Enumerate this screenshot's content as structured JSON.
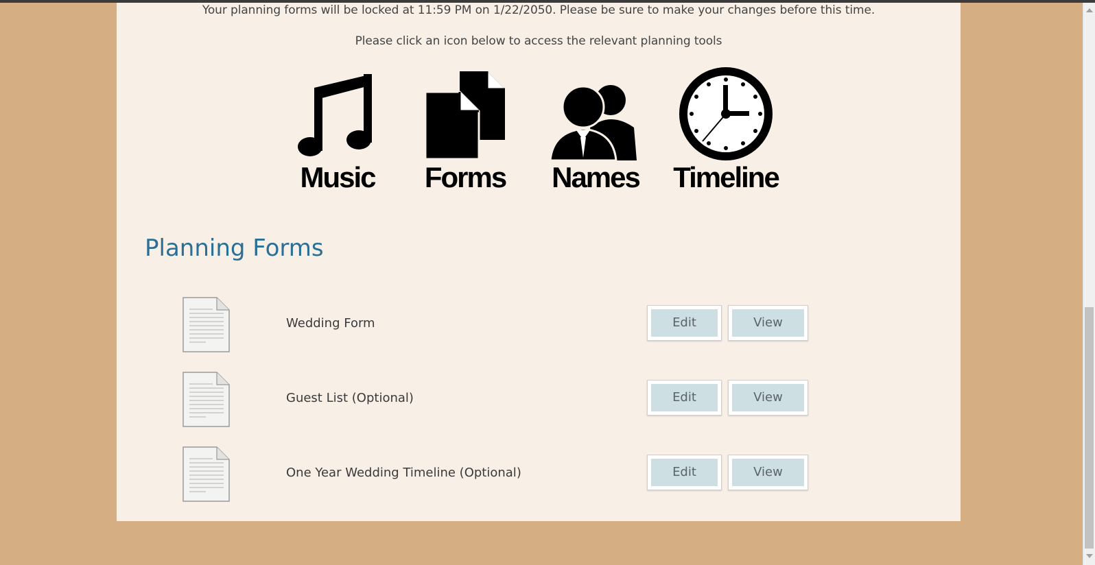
{
  "notices": {
    "lock": "Your planning forms will be locked at 11:59 PM on 1/22/2050. Please be sure to make your changes before this time.",
    "click": "Please click an icon below to access the relevant planning tools"
  },
  "tools": [
    {
      "label": "Music",
      "icon": "music-note-icon"
    },
    {
      "label": "Forms",
      "icon": "documents-icon"
    },
    {
      "label": "Names",
      "icon": "people-icon"
    },
    {
      "label": "Timeline",
      "icon": "clock-icon"
    }
  ],
  "planning": {
    "title": "Planning Forms",
    "forms": [
      {
        "name": "Wedding Form",
        "edit": "Edit",
        "view": "View"
      },
      {
        "name": "Guest List (Optional)",
        "edit": "Edit",
        "view": "View"
      },
      {
        "name": "One Year Wedding Timeline (Optional)",
        "edit": "Edit",
        "view": "View"
      }
    ]
  },
  "colors": {
    "background": "#d6ae84",
    "panel": "#f8efe6",
    "title": "#2a6f96",
    "button": "#cddfe3"
  }
}
